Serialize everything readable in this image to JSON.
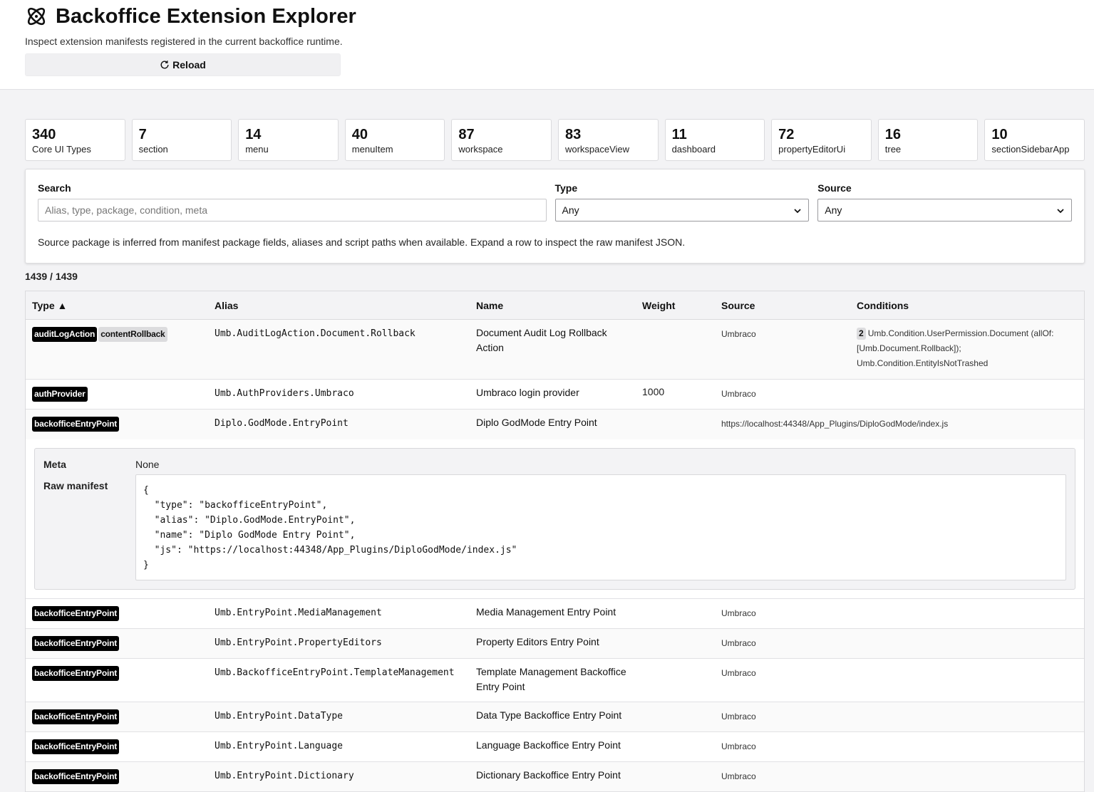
{
  "header": {
    "title": "Backoffice Extension Explorer",
    "subtitle": "Inspect extension manifests registered in the current backoffice runtime.",
    "reload_label": "Reload",
    "logo_icon": "atom-icon",
    "reload_icon": "refresh-icon"
  },
  "stats": [
    {
      "count": "340",
      "label": "Core UI Types"
    },
    {
      "count": "7",
      "label": "section"
    },
    {
      "count": "14",
      "label": "menu"
    },
    {
      "count": "40",
      "label": "menuItem"
    },
    {
      "count": "87",
      "label": "workspace"
    },
    {
      "count": "83",
      "label": "workspaceView"
    },
    {
      "count": "11",
      "label": "dashboard"
    },
    {
      "count": "72",
      "label": "propertyEditorUi"
    },
    {
      "count": "16",
      "label": "tree"
    },
    {
      "count": "10",
      "label": "sectionSidebarApp"
    }
  ],
  "filters": {
    "search_label": "Search",
    "search_placeholder": "Alias, type, package, condition, meta",
    "type_label": "Type",
    "type_value": "Any",
    "source_label": "Source",
    "source_value": "Any",
    "hint": "Source package is inferred from manifest package fields, aliases and script paths when available. Expand a row to inspect the raw manifest JSON."
  },
  "result_count": "1439 / 1439",
  "table": {
    "headers": {
      "type": "Type ▲",
      "alias": "Alias",
      "name": "Name",
      "weight": "Weight",
      "source": "Source",
      "conditions": "Conditions"
    },
    "rows": [
      {
        "type": "auditLogAction",
        "kind": "contentRollback",
        "alias": "Umb.AuditLogAction.Document.Rollback",
        "name": "Document Audit Log Rollback Action",
        "weight": "",
        "source": "Umbraco",
        "condition_count": "2",
        "conditions": "Umb.Condition.UserPermission.Document (allOf: [Umb.Document.Rollback]); Umb.Condition.EntityIsNotTrashed"
      },
      {
        "type": "authProvider",
        "alias": "Umb.AuthProviders.Umbraco",
        "name": "Umbraco login provider",
        "weight": "1000",
        "source": "Umbraco"
      },
      {
        "type": "backofficeEntryPoint",
        "alias": "Diplo.GodMode.EntryPoint",
        "name": "Diplo GodMode Entry Point",
        "weight": "",
        "source": "https://localhost:44348/App_Plugins/DiploGodMode/index.js"
      }
    ],
    "expanded": {
      "meta_label": "Meta",
      "meta_value": "None",
      "raw_label": "Raw manifest",
      "raw_json": "{\n  \"type\": \"backofficeEntryPoint\",\n  \"alias\": \"Diplo.GodMode.EntryPoint\",\n  \"name\": \"Diplo GodMode Entry Point\",\n  \"js\": \"https://localhost:44348/App_Plugins/DiploGodMode/index.js\"\n}"
    },
    "rows_after": [
      {
        "type": "backofficeEntryPoint",
        "alias": "Umb.EntryPoint.MediaManagement",
        "name": "Media Management Entry Point",
        "source": "Umbraco"
      },
      {
        "type": "backofficeEntryPoint",
        "alias": "Umb.EntryPoint.PropertyEditors",
        "name": "Property Editors Entry Point",
        "source": "Umbraco"
      },
      {
        "type": "backofficeEntryPoint",
        "alias": "Umb.BackofficeEntryPoint.TemplateManagement",
        "name": "Template Management Backoffice Entry Point",
        "source": "Umbraco"
      },
      {
        "type": "backofficeEntryPoint",
        "alias": "Umb.EntryPoint.DataType",
        "name": "Data Type Backoffice Entry Point",
        "source": "Umbraco"
      },
      {
        "type": "backofficeEntryPoint",
        "alias": "Umb.EntryPoint.Language",
        "name": "Language Backoffice Entry Point",
        "source": "Umbraco"
      },
      {
        "type": "backofficeEntryPoint",
        "alias": "Umb.EntryPoint.Dictionary",
        "name": "Dictionary Backoffice Entry Point",
        "source": "Umbraco"
      }
    ]
  }
}
